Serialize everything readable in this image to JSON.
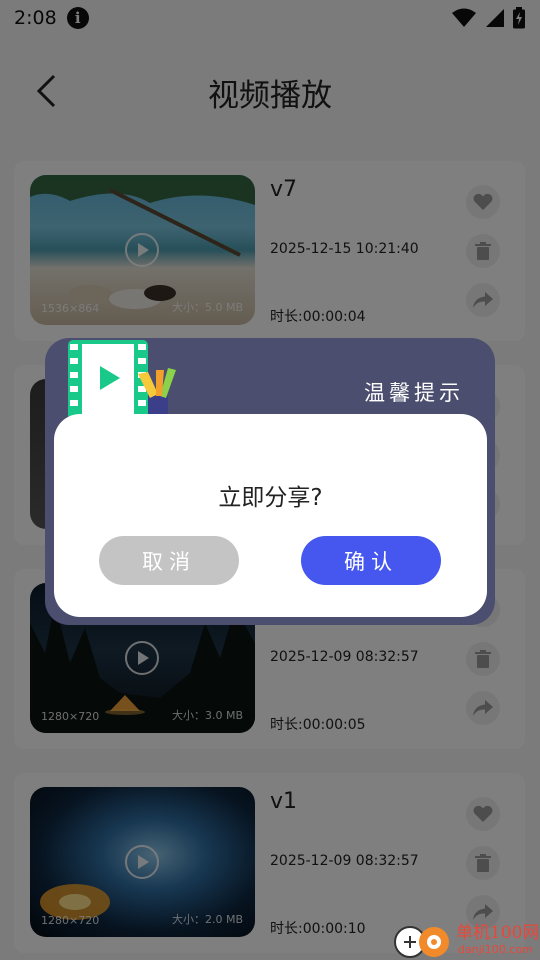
{
  "status_bar": {
    "time": "2:08"
  },
  "header": {
    "title": "视频播放"
  },
  "videos": [
    {
      "name": "v7",
      "date": "2025-12-15 10:21:40",
      "duration": "时长:00:00:04",
      "resolution": "1536×864",
      "size": "大小：5.0 MB"
    },
    {
      "name": "",
      "date": "",
      "duration": "",
      "resolution": "",
      "size": ""
    },
    {
      "name": "",
      "date": "2025-12-09 08:32:57",
      "duration": "时长:00:00:05",
      "resolution": "1280×720",
      "size": "大小：3.0 MB"
    },
    {
      "name": "v1",
      "date": "2025-12-09 08:32:57",
      "duration": "时长:00:00:10",
      "resolution": "1280×720",
      "size": "大小：2.0 MB"
    }
  ],
  "dialog": {
    "title": "温馨提示",
    "message": "立即分享?",
    "cancel_label": "取消",
    "confirm_label": "确认"
  },
  "watermark": {
    "brand": "单机100网",
    "url": "danji100.com"
  },
  "colors": {
    "confirm": "#4557ee",
    "cancel": "#c4c4c4",
    "dialog_header": "#4b4e6e",
    "watermark": "#e9473a"
  }
}
